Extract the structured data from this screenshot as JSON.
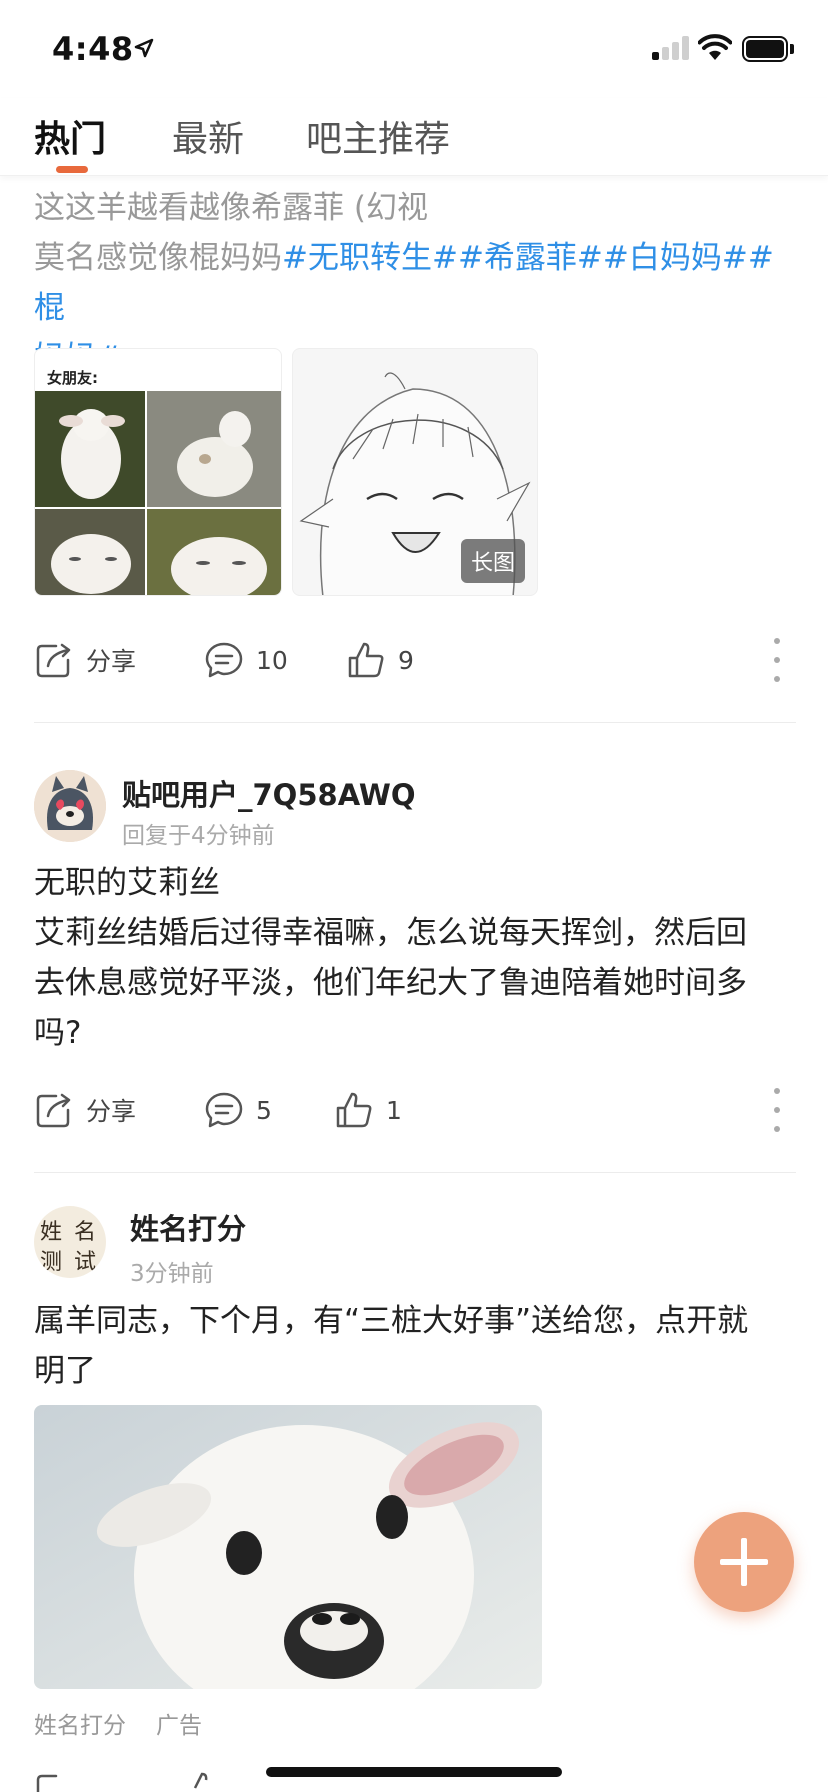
{
  "status": {
    "time": "4:48"
  },
  "tabs": [
    {
      "label": "热门",
      "active": true
    },
    {
      "label": "最新",
      "active": false
    },
    {
      "label": "吧主推荐",
      "active": false
    }
  ],
  "posts": [
    {
      "truncated_line": "这这羊越看越像希露菲 (幻视",
      "body_prefix": "莫名感觉像棍妈妈",
      "hashtags": "#无职转生##希露菲##白妈妈##棍",
      "hashtags_line2": "妈妈#",
      "images": [
        {
          "name": "goat-meme-image",
          "top_caption": "女朋友:"
        },
        {
          "name": "anime-sketch-image",
          "badge": "长图"
        }
      ],
      "actions": {
        "share": "分享",
        "comments": "10",
        "likes": "9"
      }
    },
    {
      "username": "贴吧用户_7Q58AWQ",
      "meta": "回复于4分钟前",
      "title": "无职的艾莉丝",
      "body": [
        "艾莉丝结婚后过得幸福嘛，怎么说每天挥剑，然后回",
        "去休息感觉好平淡，他们年纪大了鲁迪陪着她时间多",
        "吗?"
      ],
      "actions": {
        "share": "分享",
        "comments": "5",
        "likes": "1"
      }
    },
    {
      "username": "姓名打分",
      "avatar_text": [
        "姓",
        "名",
        "测",
        "试"
      ],
      "meta": "3分钟前",
      "body": [
        "属羊同志，下个月，有“三桩大好事”送给您，点开就",
        "明了"
      ],
      "footer": {
        "source": "姓名打分",
        "ad_label": "广告"
      }
    }
  ],
  "colors": {
    "accent": "#e8693c",
    "hashtag": "#2f8fe6",
    "fab": "#eda27d"
  }
}
